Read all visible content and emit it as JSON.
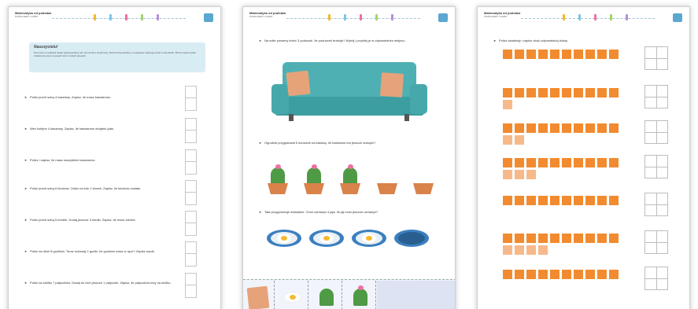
{
  "header": {
    "title": "Matematyka od podstaw",
    "subtitle": "POZNAJEMY LICZBY",
    "flag_colors": [
      "#f4b92c",
      "#7bc6e8",
      "#f06fa5",
      "#a4d36b",
      "#b78fd8"
    ],
    "badge_color": "#5aa7d0"
  },
  "page1": {
    "hint_title": "Nauczycielu!",
    "hint_text": "Pomocne w realizacji zadań będą kasztany lub inne drobne przedmioty. Dzieci liczą kasztany, a następnie zapisują wynik w okienkach. Można wykorzystać zadania do pracy w parach lub w małych grupach.",
    "tasks": [
      "Połóż przed sobą 4 kasztany. Zapisz, ile masz kasztanów.",
      "Weź kolejne 4 kasztany. Zapisz, ile kasztanów wziąłeś/-ęłaś.",
      "Policz i zapisz, ile masz wszystkich kasztanów.",
      "Połóż przed sobą 6 klocków. Odłóż na bok 1 klocek. Zapisz, ile klocków zostało.",
      "Połóż przed sobą 5 kredek. Dodaj jeszcze 3 kredki. Zapisz, ile masz kredek.",
      "Połóż na dłoni 8 guzików. Teraz schowaj 2 guziki. Ile guzików masz w ręce? Zapisz wynik.",
      "Połóż na stoliku 7 patyczków. Dodaj do nich jeszcze 1 patyczek. Zapisz, ile patyczków leży na stoliku."
    ]
  },
  "page2": {
    "tasks": [
      "Na sofie powinny leżeć 3 poduszki. Ile poduszek brakuje? Wytnij i przyklej je w odpowiednim miejscu.",
      "Ogrodnik przygotował 5 doniczek na kaktusy. Ile kaktusów ma jeszcze dokupić?",
      "Tata przygotowuje śniadanie. Chce usmażyć 4 jaja. Ile jaj musi jeszcze usmażyć?"
    ],
    "colors": {
      "sofa": "#4fb0b3",
      "pillow": "#e6a37a",
      "cactus": "#4f9a45",
      "pot": "#d9824a",
      "plate": "#3c7fbf"
    }
  },
  "page3": {
    "instruction": "Policz kwadraty i zapisz obok odpowiednią liczbę.",
    "rows": [
      {
        "dark": 10,
        "light": 0
      },
      {
        "dark": 10,
        "light": 1
      },
      {
        "dark": 10,
        "light": 2
      },
      {
        "dark": 10,
        "light": 3
      },
      {
        "dark": 10,
        "light": 0
      },
      {
        "dark": 10,
        "light": 4
      },
      {
        "dark": 10,
        "light": 0
      }
    ],
    "colors": {
      "dark": "#f28b2f",
      "light": "#f7b98a"
    }
  }
}
